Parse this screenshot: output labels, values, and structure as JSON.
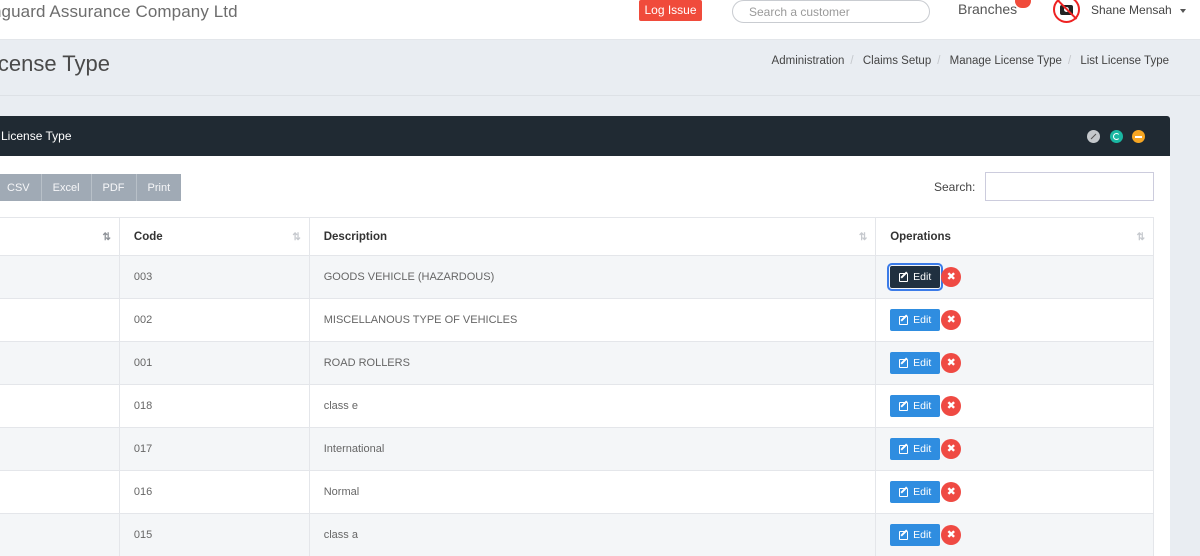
{
  "header": {
    "app_title": "nguard Assurance Company Ltd",
    "log_issue_label": "Log Issue",
    "search_placeholder": "Search a customer",
    "branches_label": "Branches",
    "user_name": "Shane Mensah"
  },
  "page": {
    "title": "icense Type",
    "breadcrumb": [
      "Administration",
      "Claims Setup",
      "Manage License Type",
      "List License Type"
    ]
  },
  "panel": {
    "title": "l License Type",
    "export_buttons": [
      "CSV",
      "Excel",
      "PDF",
      "Print"
    ],
    "search_label": "Search:"
  },
  "table": {
    "columns": [
      "",
      "Code",
      "Description",
      "Operations"
    ],
    "edit_label": "Edit",
    "delete_glyph": "✖",
    "rows": [
      {
        "code": "003",
        "description": "GOODS VEHICLE (HAZARDOUS)",
        "focused": true
      },
      {
        "code": "002",
        "description": "MISCELLANOUS TYPE OF VEHICLES",
        "focused": false
      },
      {
        "code": "001",
        "description": "ROAD ROLLERS",
        "focused": false
      },
      {
        "code": "018",
        "description": "class e",
        "focused": false
      },
      {
        "code": "017",
        "description": "International",
        "focused": false
      },
      {
        "code": "016",
        "description": "Normal",
        "focused": false
      },
      {
        "code": "015",
        "description": "class a",
        "focused": false
      }
    ]
  },
  "colors": {
    "accent": "#2f8de0",
    "danger": "#ef4a43",
    "panel_header": "#202a33"
  }
}
